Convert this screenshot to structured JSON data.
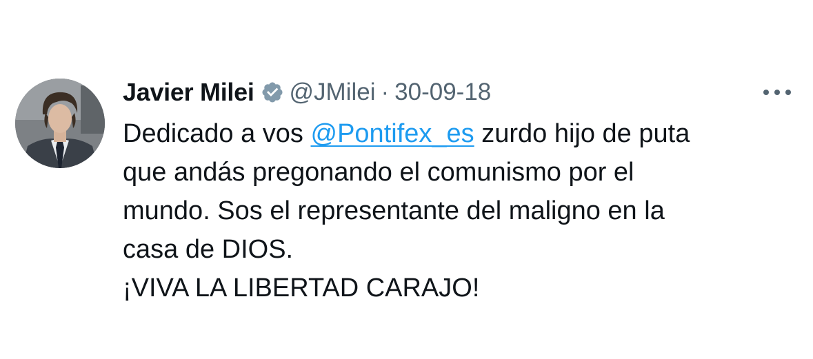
{
  "tweet": {
    "author": {
      "display_name": "Javier Milei",
      "handle": "@JMilei",
      "avatar_icon": "profile-photo",
      "verified_icon": "verified-badge-icon",
      "verified_color": "#829aab"
    },
    "separator": "·",
    "date": "30-09-18",
    "more_icon": "more-horizontal-icon",
    "lines": [
      {
        "before": "Dedicado a vos ",
        "mention": "@Pontifex_es",
        "after": " zurdo hijo de puta"
      },
      {
        "text": "que andás pregonando el comunismo por el"
      },
      {
        "text": "mundo. Sos el representante del maligno en la"
      },
      {
        "text": "casa de DIOS."
      },
      {
        "text": "¡VIVA LA LIBERTAD CARAJO!"
      }
    ],
    "colors": {
      "text": "#0f1419",
      "secondary": "#536471",
      "link": "#1d9bf0"
    }
  }
}
